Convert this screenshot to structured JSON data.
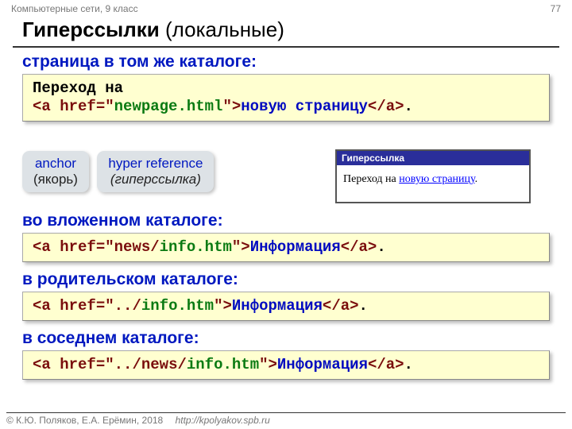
{
  "meta": {
    "subject": "Компьютерные сети, 9 класс",
    "slide_no": "77",
    "copyright": "© К.Ю. Поляков, Е.А. Ерёмин, 2018",
    "url": "http://kpolyakov.spb.ru"
  },
  "title": {
    "bold": "Гиперссылки",
    "rest": " (локальные)"
  },
  "sec1": {
    "label": "страница в том же каталоге:",
    "code_line1": "Переход на",
    "code_open": "<a ",
    "code_href": "href",
    "code_eq": "=",
    "code_q1": "\"",
    "code_file": "newpage.html",
    "code_q2": "\"",
    "code_gt": ">",
    "code_text": "новую страницу",
    "code_close": "</a>",
    "code_dot": "."
  },
  "chips": {
    "a": {
      "en": "anchor",
      "ru": "(якорь)"
    },
    "b": {
      "en": "hyper reference",
      "ru": "(гиперссылка)"
    }
  },
  "preview": {
    "title": "Гиперссылка",
    "pre": "Переход на ",
    "link": "новую страницу",
    "post": "."
  },
  "sec2": {
    "label": "во вложенном каталоге:",
    "a_open": "<a ",
    "href": "href",
    "eq": "=",
    "q1": "\"",
    "dir": "news/",
    "file": "info.htm",
    "q2": "\"",
    "gt": ">",
    "text": "Информация",
    "close": "</a>",
    "dot": "."
  },
  "sec3": {
    "label": "в родительском каталоге:",
    "a_open": "<a ",
    "href": "href",
    "eq": "=",
    "q1": "\"",
    "up": "../",
    "file": "info.htm",
    "q2": "\"",
    "gt": ">",
    "text": "Информация",
    "close": "</a>",
    "dot": "."
  },
  "sec4": {
    "label": "в соседнем каталоге:",
    "a_open": "<a ",
    "href": "href",
    "eq": "=",
    "q1": "\"",
    "up": "../",
    "dir": "news/",
    "file": "info.htm",
    "q2": "\"",
    "gt": ">",
    "text": "Информация",
    "close": "</a>",
    "dot": "."
  }
}
